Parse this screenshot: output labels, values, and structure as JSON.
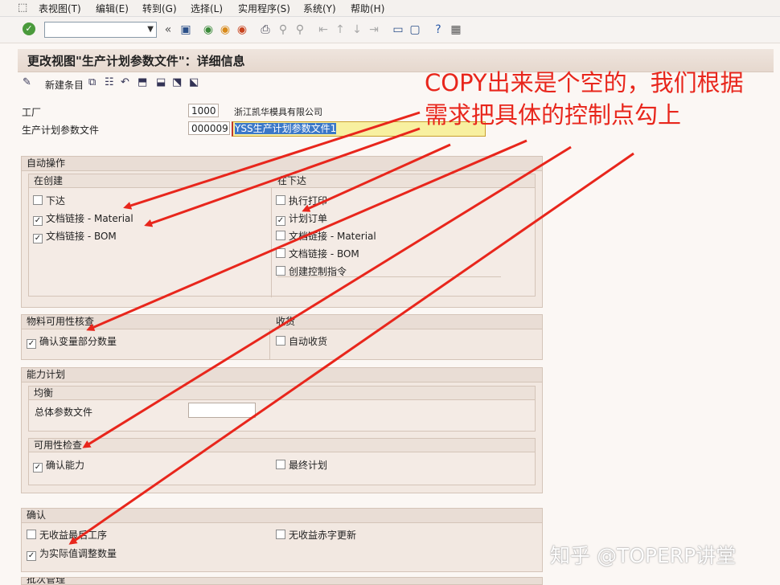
{
  "menubar": {
    "items": [
      "表视图(T)",
      "编辑(E)",
      "转到(G)",
      "选择(L)",
      "实用程序(S)",
      "系统(Y)",
      "帮助(H)"
    ]
  },
  "toolbar": {
    "command_field_value": ""
  },
  "screen": {
    "title": "更改视图\"生产计划参数文件\"：详细信息",
    "new_entries_label": "新建条目"
  },
  "header_fields": {
    "plant_label": "工厂",
    "plant_value": "1000",
    "plant_desc": "浙江凯华模具有限公司",
    "profile_label": "生产计划参数文件",
    "profile_value": "000009",
    "profile_desc": "YSS生产计划参数文件1"
  },
  "auto_ops": {
    "title": "自动操作",
    "on_create": {
      "title": "在创建",
      "items": [
        {
          "label": "下达",
          "checked": false
        },
        {
          "label": "文档链接 - Material",
          "checked": true
        },
        {
          "label": "文档链接 - BOM",
          "checked": true
        }
      ]
    },
    "on_release": {
      "title": "在下达",
      "items": [
        {
          "label": "执行打印",
          "checked": false
        },
        {
          "label": "计划订单",
          "checked": true
        },
        {
          "label": "文档链接 - Material",
          "checked": false
        },
        {
          "label": "文档链接 - BOM",
          "checked": false
        },
        {
          "label": "创建控制指令",
          "checked": false
        }
      ]
    }
  },
  "material_check": {
    "title": "物料可用性核查",
    "items": [
      {
        "label": "确认变量部分数量",
        "checked": true
      }
    ]
  },
  "goods_receipt": {
    "title": "收货",
    "items": [
      {
        "label": "自动收货",
        "checked": false
      }
    ]
  },
  "capacity": {
    "title": "能力计划",
    "leveling": {
      "title": "均衡",
      "overall_profile_label": "总体参数文件",
      "overall_profile_value": ""
    },
    "availability": {
      "title": "可用性检查",
      "items": [
        {
          "label": "确认能力",
          "checked": true
        },
        {
          "label": "最终计划",
          "checked": false
        }
      ]
    }
  },
  "confirmation": {
    "title": "确认",
    "items": [
      {
        "label": "无收益最后工序",
        "checked": false
      },
      {
        "label": "无收益赤字更新",
        "checked": false
      },
      {
        "label": "为实际值调整数量",
        "checked": true
      }
    ]
  },
  "next_section_title": "批次管理",
  "annotation": {
    "line1": "COPY出来是个空的，我们根据",
    "line2": "需求把具体的控制点勾上",
    "color": "#e8261c"
  },
  "watermark": "知乎 @TOPERP讲堂",
  "icons": [
    "enter-icon",
    "save-icon",
    "back-icon",
    "exit-icon",
    "cancel-icon",
    "print-icon",
    "find-icon",
    "find-next-icon",
    "first-page-icon",
    "prev-page-icon",
    "next-page-icon",
    "last-page-icon",
    "new-session-icon",
    "shortcut-icon",
    "help-icon",
    "layout-icon"
  ]
}
